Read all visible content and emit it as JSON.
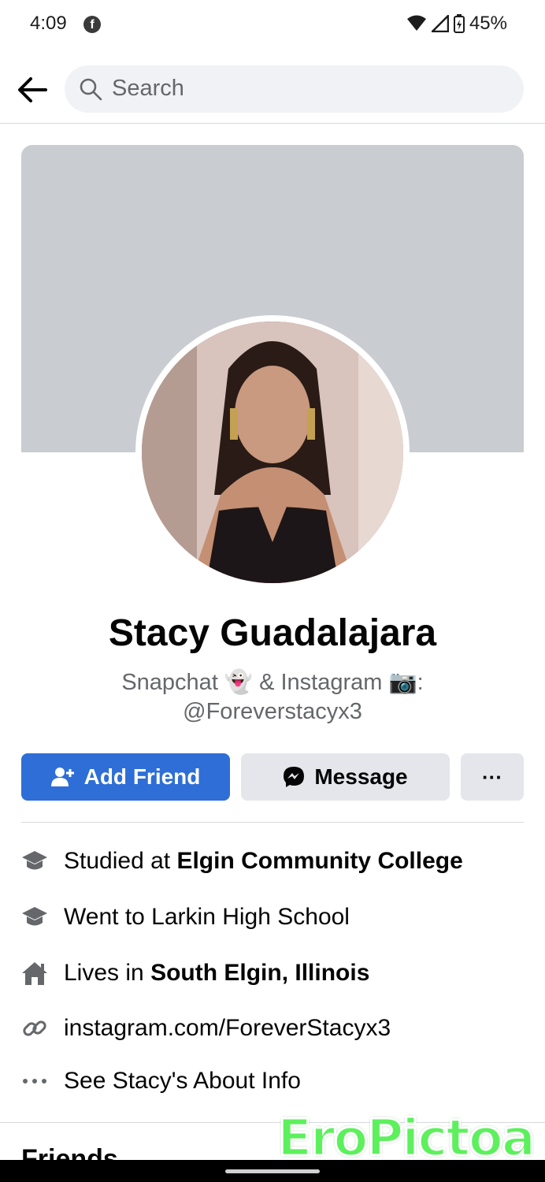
{
  "status_bar": {
    "time": "4:09",
    "app_badge": "f",
    "battery": "45%"
  },
  "search": {
    "placeholder": "Search"
  },
  "profile": {
    "name": "Stacy Guadalajara",
    "bio_line1": "Snapchat 👻 & Instagram 📷:",
    "bio_line2": "@Foreverstacyx3"
  },
  "actions": {
    "add_friend": "Add Friend",
    "message": "Message",
    "more": "···"
  },
  "info": {
    "studied_prefix": "Studied at ",
    "studied_school": "Elgin Community College",
    "went_to": "Went to Larkin High School",
    "lives_prefix": "Lives in ",
    "lives_place": "South Elgin, Illinois",
    "link": "instagram.com/ForeverStacyx3",
    "about": "See Stacy's About Info"
  },
  "sections": {
    "friends": "Friends"
  },
  "watermark": "EroPictoa",
  "colors": {
    "accent": "#2e6ed6",
    "cover": "#c9ccd1",
    "secondary_text": "#65676b"
  },
  "icons": [
    "facebook-icon",
    "wifi-icon",
    "signal-icon",
    "battery-icon",
    "back-arrow-icon",
    "search-icon",
    "add-person-icon",
    "messenger-icon",
    "graduation-cap-icon",
    "house-icon",
    "link-icon",
    "more-dots-icon"
  ]
}
